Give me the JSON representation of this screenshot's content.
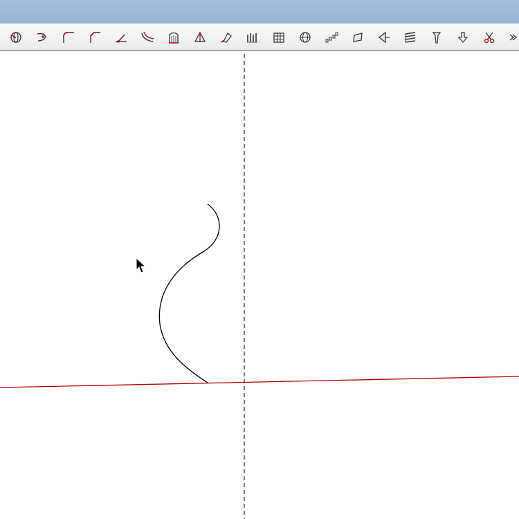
{
  "window": {
    "titlebar_color": "#9eb6d6"
  },
  "toolbar": {
    "tools": [
      {
        "name": "camera-orbit-icon"
      },
      {
        "name": "look-around-icon"
      },
      {
        "name": "fillet-icon"
      },
      {
        "name": "chamfer-icon"
      },
      {
        "name": "extend-line-icon"
      },
      {
        "name": "offset-curve-icon"
      },
      {
        "name": "loft-icon"
      },
      {
        "name": "sweep-icon"
      },
      {
        "name": "paint-icon"
      },
      {
        "name": "array-icon"
      },
      {
        "name": "grid-array-icon"
      },
      {
        "name": "sphere-mesh-icon"
      },
      {
        "name": "curve-array-icon"
      },
      {
        "name": "surface-icon"
      },
      {
        "name": "project-icon"
      },
      {
        "name": "stack-icon"
      },
      {
        "name": "pin-icon"
      },
      {
        "name": "push-down-icon"
      },
      {
        "name": "scissors-icon"
      },
      {
        "name": "more-tools-icon"
      }
    ]
  },
  "viewport": {
    "background": "#ffffff",
    "x_axis_color": "#b00000",
    "curve_color": "#000000",
    "guide_line_color": "#222222"
  }
}
